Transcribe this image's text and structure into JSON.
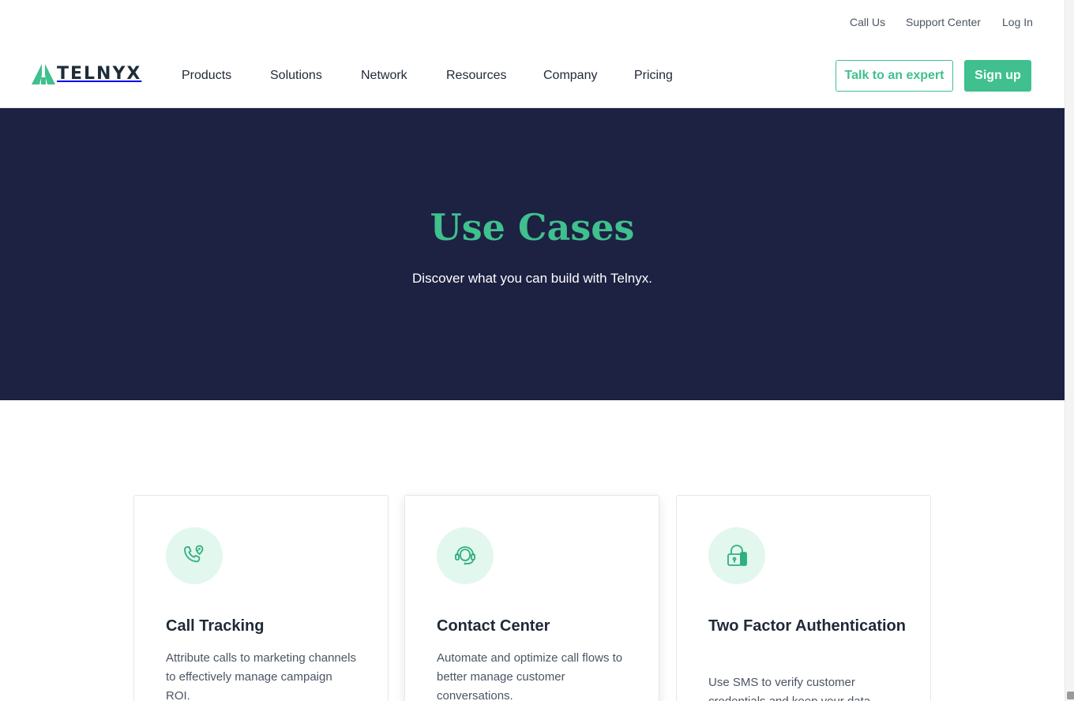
{
  "utility_nav": {
    "call_us": "Call Us",
    "support_center": "Support Center",
    "log_in": "Log In"
  },
  "brand": {
    "name": "TELNYX",
    "accent_color": "#3fc08e",
    "dark_color": "#1d2142"
  },
  "main_nav": {
    "items": [
      "Products",
      "Solutions",
      "Network",
      "Resources",
      "Company",
      "Pricing"
    ]
  },
  "cta": {
    "talk_expert": "Talk to an expert",
    "sign_up": "Sign up"
  },
  "hero": {
    "title": "Use Cases",
    "subtitle": "Discover what you can build with Telnyx."
  },
  "cards": [
    {
      "icon": "phone-location-icon",
      "title": "Call Tracking",
      "description": "Attribute calls to marketing channels to effectively manage campaign ROI."
    },
    {
      "icon": "headset-agent-icon",
      "title": "Contact Center",
      "description": "Automate and optimize call flows to better manage customer conversations."
    },
    {
      "icon": "padlock-phone-icon",
      "title": "Two Factor Authentication",
      "description": "Use SMS to verify customer credentials and keep your data secure."
    }
  ]
}
